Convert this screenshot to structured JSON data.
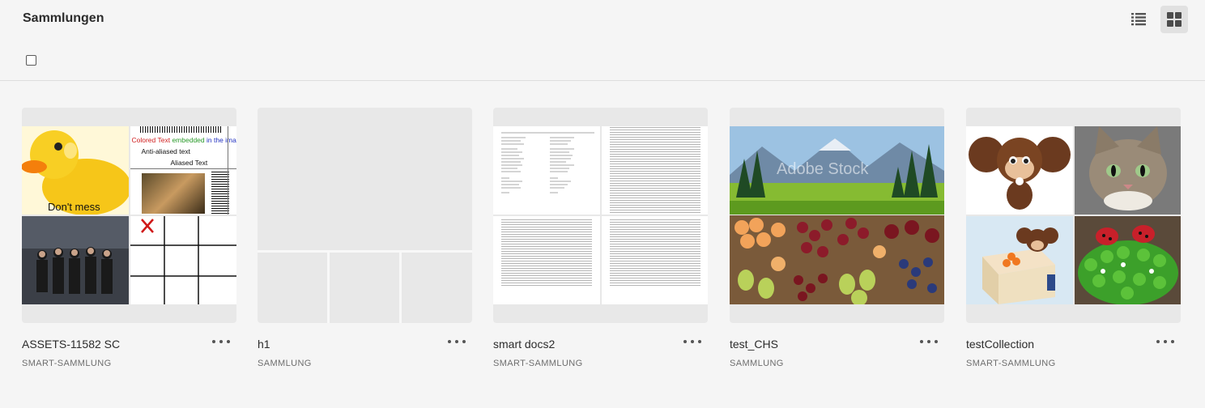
{
  "header": {
    "title": "Sammlungen",
    "list_view_icon": "list-view-icon",
    "grid_view_icon": "grid-view-icon"
  },
  "cards": [
    {
      "name": "ASSETS-11582 SC",
      "type": "SMART-SAMMLUNG",
      "thumb_texts": {
        "colored": "Colored Text",
        "embedded": "embedded",
        "in_image": "in the image",
        "anti_aliased": "Anti-aliased text",
        "aliased": "Aliased Text",
        "dont_mess": "Don't mess"
      }
    },
    {
      "name": "h1",
      "type": "SAMMLUNG"
    },
    {
      "name": "smart docs2",
      "type": "SMART-SAMMLUNG"
    },
    {
      "name": "test_CHS",
      "type": "SAMMLUNG",
      "thumb_texts": {
        "watermark": "Adobe Stock"
      }
    },
    {
      "name": "testCollection",
      "type": "SMART-SAMMLUNG"
    }
  ],
  "colors": {
    "background": "#f5f5f5",
    "thumb_bg": "#e8e8e8",
    "active_toggle": "#e1e1e1"
  }
}
